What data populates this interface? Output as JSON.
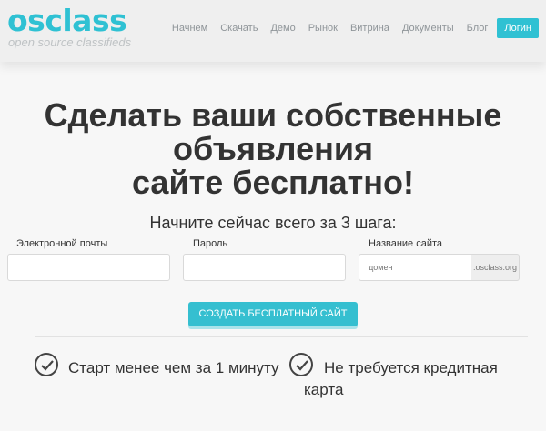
{
  "header": {
    "logo": "osclass",
    "tagline": "open source classifieds",
    "nav": [
      "Начнем",
      "Скачать",
      "Демо",
      "Рынок",
      "Витрина",
      "Документы",
      "Блог"
    ],
    "login_label": "Логин"
  },
  "hero": {
    "headline_line1": "Сделать ваши собственные",
    "headline_line2": "объявления",
    "headline_line3": "сайте бесплатно!",
    "subhead": "Начните сейчас всего за 3 шага:"
  },
  "form": {
    "email_label": "Электронной почты",
    "password_label": "Пароль",
    "site_label": "Название сайта",
    "site_placeholder": "домен",
    "site_suffix": ".osclass.org",
    "submit_label": "СОЗДАТЬ БЕСПЛАТНЫЙ САЙТ"
  },
  "features": {
    "item1": "Старт менее чем за 1 минуту",
    "item2_line1": "Не требуется кредитная",
    "item2_line2": "карта"
  },
  "colors": {
    "accent": "#2fc1d3",
    "button": "#35bfd0"
  }
}
